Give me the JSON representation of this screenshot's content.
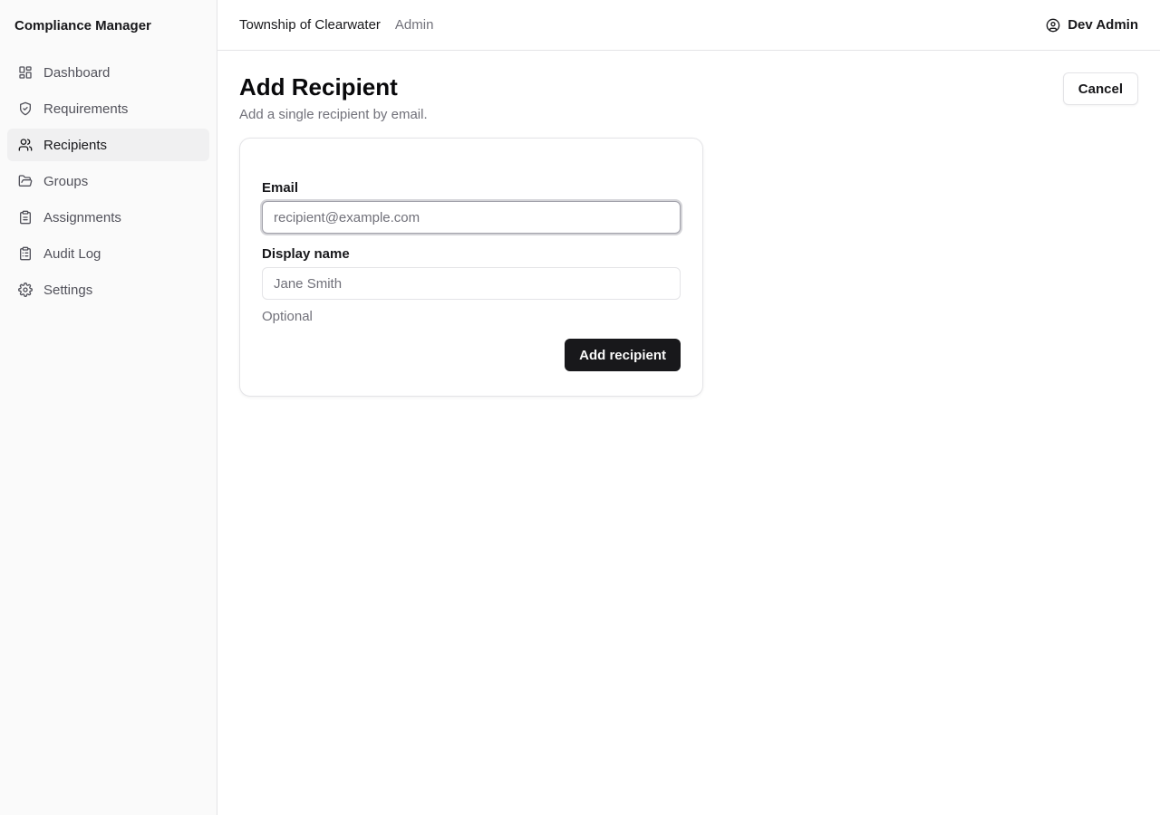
{
  "app": {
    "title": "Compliance Manager"
  },
  "sidebar": {
    "items": [
      {
        "label": "Dashboard",
        "icon": "dashboard-icon",
        "active": false
      },
      {
        "label": "Requirements",
        "icon": "shield-check-icon",
        "active": false
      },
      {
        "label": "Recipients",
        "icon": "users-icon",
        "active": true
      },
      {
        "label": "Groups",
        "icon": "folder-open-icon",
        "active": false
      },
      {
        "label": "Assignments",
        "icon": "clipboard-icon",
        "active": false
      },
      {
        "label": "Audit Log",
        "icon": "clipboard-list-icon",
        "active": false
      },
      {
        "label": "Settings",
        "icon": "gear-icon",
        "active": false
      }
    ]
  },
  "topbar": {
    "org": "Township of Clearwater",
    "role": "Admin",
    "user": "Dev Admin",
    "user_icon": "user-circle-icon"
  },
  "page": {
    "title": "Add Recipient",
    "subtitle": "Add a single recipient by email.",
    "cancel_label": "Cancel"
  },
  "form": {
    "email": {
      "label": "Email",
      "placeholder": "recipient@example.com",
      "value": ""
    },
    "display_name": {
      "label": "Display name",
      "placeholder": "Jane Smith",
      "value": "",
      "hint": "Optional"
    },
    "submit_label": "Add recipient"
  },
  "colors": {
    "accent": "#18181b",
    "sidebar_bg": "#fafafa",
    "active_item_bg": "#f0f0f1",
    "muted_text": "#71717a",
    "border": "#e4e4e7"
  }
}
